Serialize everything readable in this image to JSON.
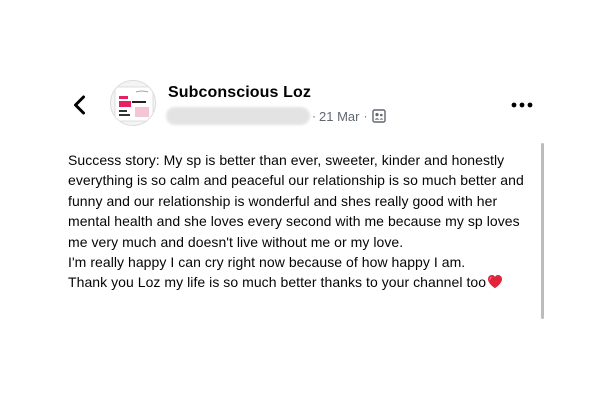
{
  "header": {
    "author_name": "Subconscious Loz",
    "date": "21 Mar",
    "meta_dot": "·",
    "meta_separator": "·",
    "back_icon": "chevron-left-icon",
    "more_icon": "more-horizontal-icon",
    "audience_icon": "friends-audience-icon"
  },
  "avatar": {
    "small_text": "Subconscious Loz",
    "accent_color": "#e91e63"
  },
  "post": {
    "body_text": "Success story: My sp is better than ever, sweeter, kinder and honestly everything is so calm and peaceful our relationship is so much better and funny and our relationship is wonderful and shes really good with her mental health and she loves every second with me because my sp loves me very much and doesn't live without me or my love.\nI'm really happy I can cry right now because of how happy I am.\nThank you Loz my life is so much better thanks to your channel too",
    "trailing_emoji": "red-heart-icon",
    "heart_color": "#e0243a"
  }
}
